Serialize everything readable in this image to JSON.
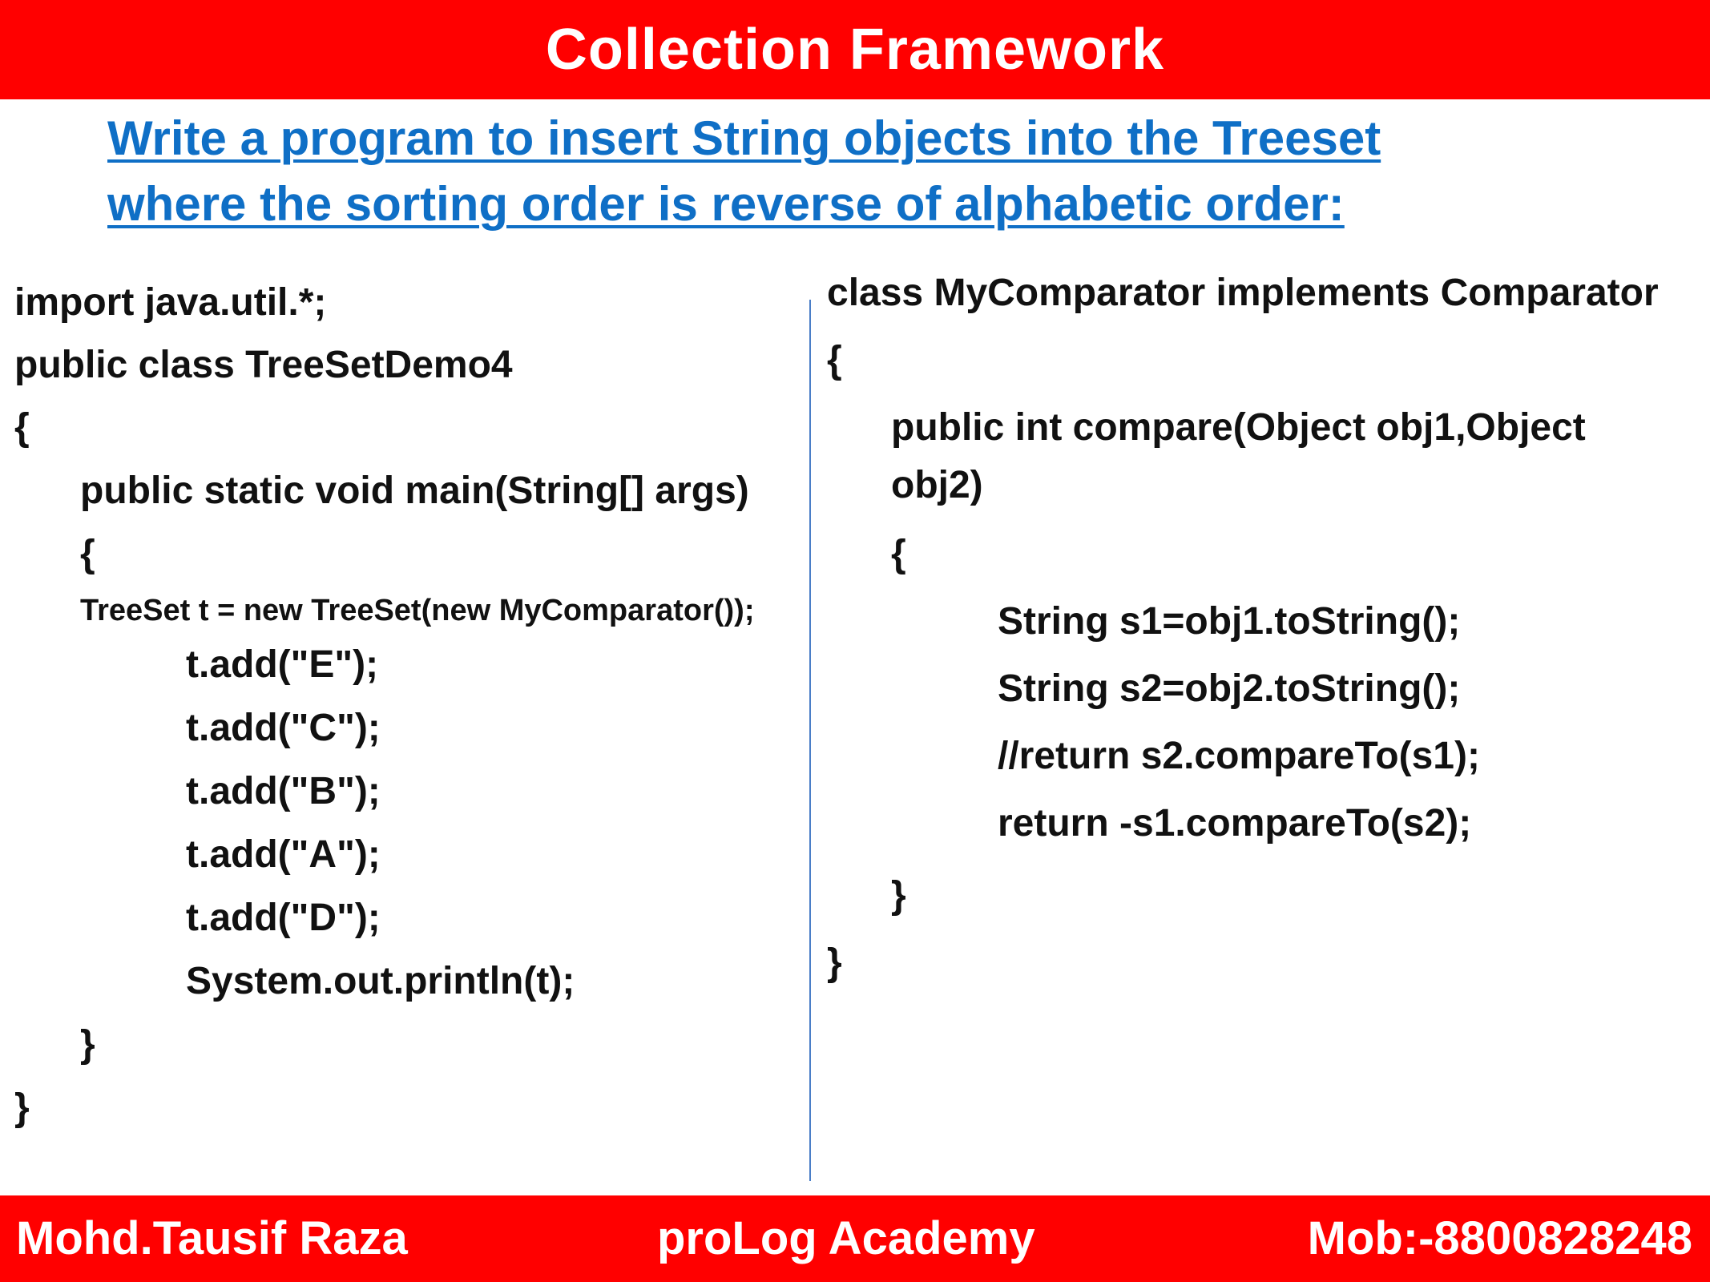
{
  "header": {
    "title": "Collection Framework"
  },
  "question": {
    "line1": "Write a program  to insert String objects into the Treeset",
    "line2": "where the sorting order is reverse of alphabetic order:"
  },
  "left_code": [
    "import java.util.*;",
    "public class TreeSetDemo4",
    "{",
    "public static void main(String[] args)",
    "{",
    "TreeSet t = new TreeSet(new MyComparator());",
    "t.add(\"E\");",
    "t.add(\"C\");",
    "t.add(\"B\");",
    "t.add(\"A\");",
    "t.add(\"D\");",
    "System.out.println(t);",
    "}",
    "}"
  ],
  "right_code": [
    "class MyComparator implements Comparator",
    "{",
    "public int compare(Object obj1,Object",
    "obj2)",
    "{",
    "String s1=obj1.toString();",
    "String s2=obj2.toString();",
    "//return s2.compareTo(s1);",
    "return -s1.compareTo(s2);",
    "}",
    "}"
  ],
  "footer": {
    "author": "Mohd.Tausif Raza",
    "academy": "proLog Academy",
    "mobile": "Mob:-8800828248"
  },
  "colors": {
    "banner": "#ff0000",
    "question": "#0f6fc6",
    "divider": "#4a7ec7"
  }
}
